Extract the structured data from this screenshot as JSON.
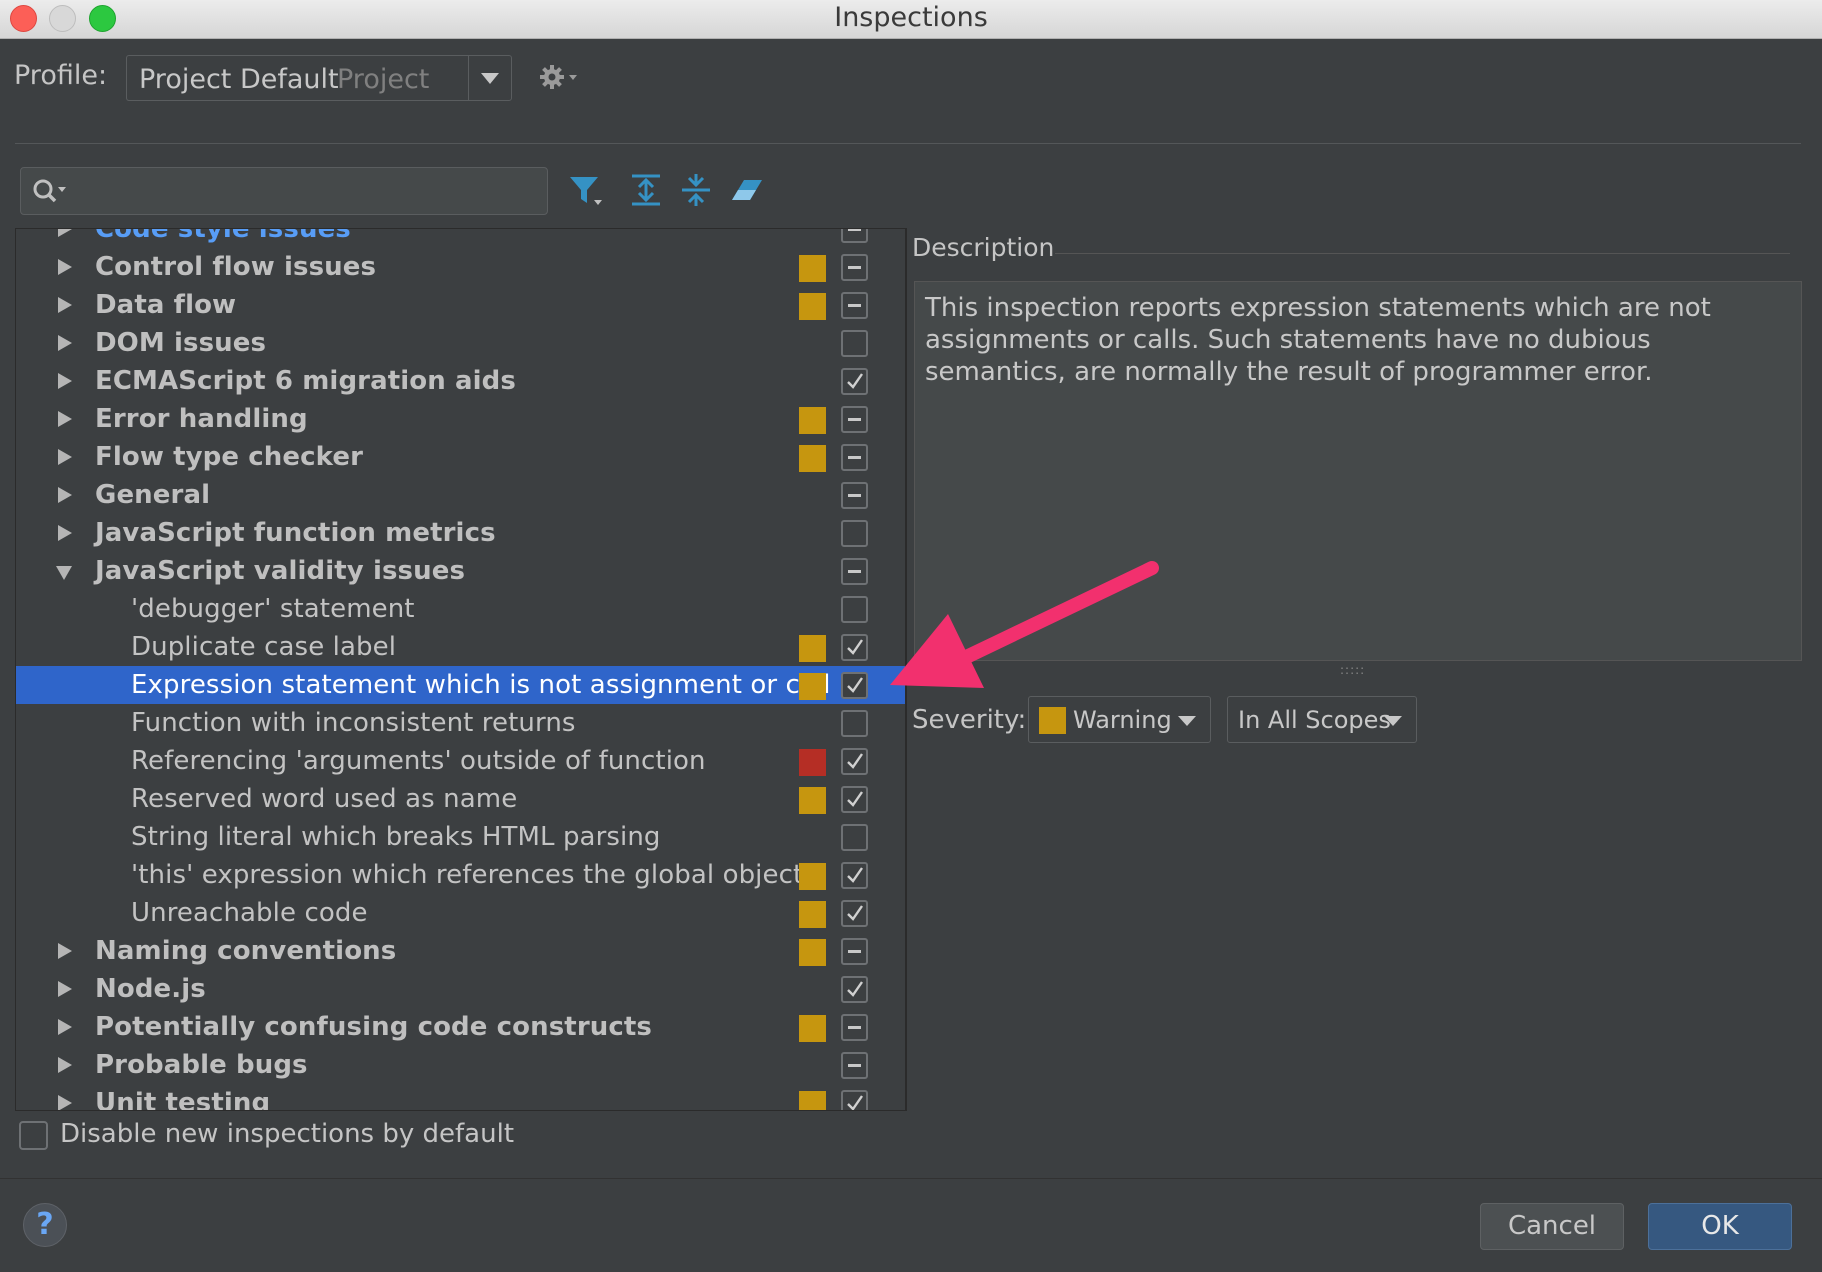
{
  "window": {
    "title": "Inspections"
  },
  "profile": {
    "label": "Profile:",
    "name": "Project Default",
    "scope": "Project"
  },
  "search": {
    "placeholder": ""
  },
  "toolbar": {
    "icons": [
      "filter-icon",
      "expand-all-icon",
      "collapse-all-icon",
      "reset-icon"
    ]
  },
  "colors": {
    "warning": "#c6960f",
    "error": "#b52e25",
    "selection": "#2f65ca",
    "link": "#589df6"
  },
  "tree": [
    {
      "type": "group",
      "label": "Code style issues",
      "severity": null,
      "check": "partial",
      "link": true
    },
    {
      "type": "group",
      "label": "Control flow issues",
      "severity": "warning",
      "check": "partial"
    },
    {
      "type": "group",
      "label": "Data flow",
      "severity": "warning",
      "check": "partial"
    },
    {
      "type": "group",
      "label": "DOM issues",
      "severity": null,
      "check": "off"
    },
    {
      "type": "group",
      "label": "ECMAScript 6 migration aids",
      "severity": null,
      "check": "on"
    },
    {
      "type": "group",
      "label": "Error handling",
      "severity": "warning",
      "check": "partial"
    },
    {
      "type": "group",
      "label": "Flow type checker",
      "severity": "warning",
      "check": "partial"
    },
    {
      "type": "group",
      "label": "General",
      "severity": null,
      "check": "partial"
    },
    {
      "type": "group",
      "label": "JavaScript function metrics",
      "severity": null,
      "check": "off"
    },
    {
      "type": "group",
      "label": "JavaScript validity issues",
      "severity": null,
      "check": "partial",
      "expanded": true
    },
    {
      "type": "item",
      "label": "'debugger' statement",
      "severity": null,
      "check": "off"
    },
    {
      "type": "item",
      "label": "Duplicate case label",
      "severity": "warning",
      "check": "on"
    },
    {
      "type": "item",
      "label": "Expression statement which is not assignment or call",
      "severity": "warning",
      "check": "on",
      "selected": true
    },
    {
      "type": "item",
      "label": "Function with inconsistent returns",
      "severity": null,
      "check": "off"
    },
    {
      "type": "item",
      "label": "Referencing 'arguments' outside of function",
      "severity": "error",
      "check": "on"
    },
    {
      "type": "item",
      "label": "Reserved word used as name",
      "severity": "warning",
      "check": "on"
    },
    {
      "type": "item",
      "label": "String literal which breaks HTML parsing",
      "severity": null,
      "check": "off"
    },
    {
      "type": "item",
      "label": "'this' expression which references the global object",
      "severity": "warning",
      "check": "on"
    },
    {
      "type": "item",
      "label": "Unreachable code",
      "severity": "warning",
      "check": "on"
    },
    {
      "type": "group",
      "label": "Naming conventions",
      "severity": "warning",
      "check": "partial"
    },
    {
      "type": "group",
      "label": "Node.js",
      "severity": null,
      "check": "on"
    },
    {
      "type": "group",
      "label": "Potentially confusing code constructs",
      "severity": "warning",
      "check": "partial"
    },
    {
      "type": "group",
      "label": "Probable bugs",
      "severity": null,
      "check": "partial"
    },
    {
      "type": "group",
      "label": "Unit testing",
      "severity": "warning",
      "check": "on"
    }
  ],
  "description": {
    "title": "Description",
    "text": "This inspection reports expression statements which are not assignments or calls. Such statements have no dubious semantics, are normally the result of programmer error."
  },
  "severity": {
    "label": "Severity:",
    "value": "Warning",
    "scope": "In All Scopes"
  },
  "footer": {
    "disable_label": "Disable new inspections by default",
    "help": "?",
    "cancel": "Cancel",
    "ok": "OK"
  }
}
